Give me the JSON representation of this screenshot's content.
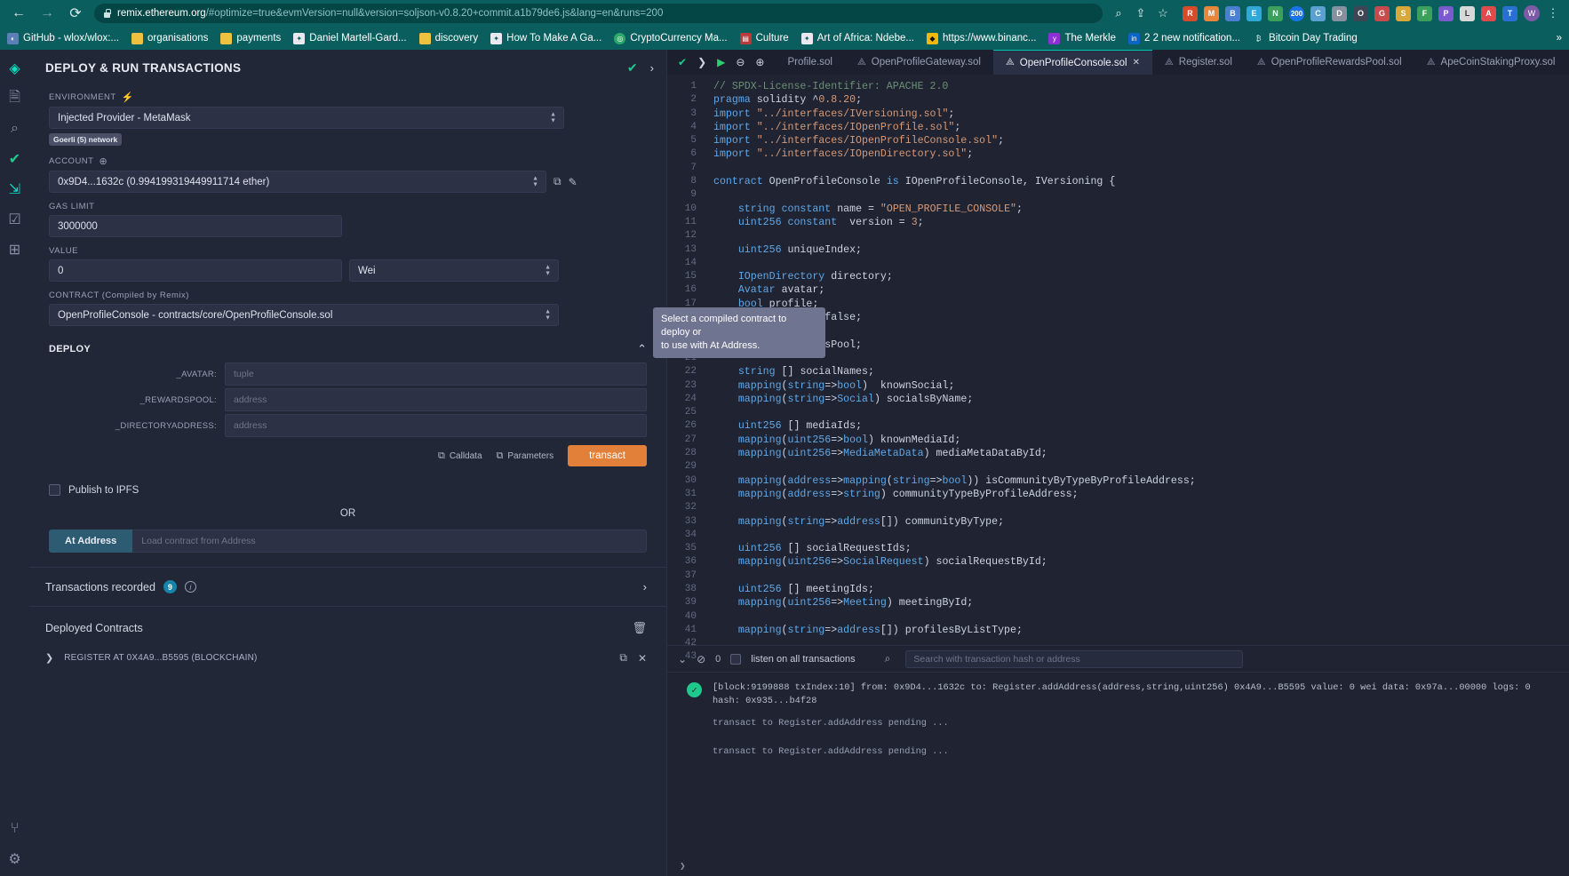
{
  "browser": {
    "nav": {
      "back": "←",
      "forward": "→",
      "reload": "⟳"
    },
    "url_main": "remix.ethereum.org",
    "url_rest": "/#optimize=true&evmVersion=null&version=soljson-v0.8.20+commit.a1b79de6.js&lang=en&runs=200",
    "url_icons": [
      "search-icon",
      "share-icon",
      "star-icon"
    ],
    "extensions": [
      "R",
      "M",
      "B",
      "E",
      "N",
      "200",
      "C",
      "D",
      "O",
      "G",
      "S",
      "F",
      "P",
      "L",
      "A",
      "T"
    ],
    "profile_initial": "W",
    "bookmarks": [
      {
        "label": "GitHub - wlox/wlox:...",
        "icon": "github-icon",
        "color": "#5a7fb5"
      },
      {
        "label": "organisations",
        "icon": "folder-icon",
        "color": "#f0c040"
      },
      {
        "label": "payments",
        "icon": "folder-icon",
        "color": "#f0c040"
      },
      {
        "label": "Daniel Martell-Gard...",
        "icon": "globe-icon",
        "color": "#e8eaf0"
      },
      {
        "label": "discovery",
        "icon": "folder-icon",
        "color": "#f0c040"
      },
      {
        "label": "How To Make A Ga...",
        "icon": "globe-icon",
        "color": "#e8eaf0"
      },
      {
        "label": "CryptoCurrency Ma...",
        "icon": "coin-icon",
        "color": "#2ea86a"
      },
      {
        "label": "Culture",
        "icon": "book-icon",
        "color": "#b83a3a"
      },
      {
        "label": "Art of Africa: Ndebe...",
        "icon": "globe-icon",
        "color": "#e8eaf0"
      },
      {
        "label": "https://www.binanc...",
        "icon": "binance-icon",
        "color": "#f0b90b"
      },
      {
        "label": "The Merkle",
        "icon": "merkle-icon",
        "color": "#8e2fd4"
      },
      {
        "label": "2 2 new notification...",
        "icon": "linkedin-icon",
        "color": "#0a66c2"
      },
      {
        "label": "Bitcoin Day Trading",
        "icon": "bitcoin-icon",
        "color": "#0b5e5e"
      }
    ],
    "bookmarks_overflow": "»"
  },
  "iconbar": {
    "items": [
      {
        "name": "remix-logo-icon",
        "glyph": "◈",
        "active": true
      },
      {
        "name": "file-explorer-icon",
        "glyph": "🗎",
        "active": false
      },
      {
        "name": "search-icon",
        "glyph": "⌕",
        "active": false
      },
      {
        "name": "solidity-compiler-icon",
        "glyph": "✔",
        "active": false
      },
      {
        "name": "deploy-run-icon",
        "glyph": "⇲",
        "active": true
      },
      {
        "name": "testing-icon",
        "glyph": "☑",
        "active": false
      },
      {
        "name": "plugin-manager-icon",
        "glyph": "⊞",
        "active": false
      }
    ],
    "bottom": [
      {
        "name": "git-icon",
        "glyph": "⑂"
      },
      {
        "name": "settings-gear-icon",
        "glyph": "⚙"
      }
    ]
  },
  "deploy_panel": {
    "title": "DEPLOY & RUN TRANSACTIONS",
    "header_icons": {
      "check": "✔",
      "chevron": "›"
    },
    "environment": {
      "label": "ENVIRONMENT",
      "plug_icon": "🔌",
      "value": "Injected Provider - MetaMask",
      "network_badge": "Goerli (5) network"
    },
    "account": {
      "label": "ACCOUNT",
      "add_icon": "⊕",
      "value": "0x9D4...1632c (0.994199319449911714 ether)",
      "copy_icon": "copy-icon",
      "edit_icon": "edit-icon"
    },
    "gas_limit": {
      "label": "GAS LIMIT",
      "value": "3000000"
    },
    "value": {
      "label": "VALUE",
      "value": "0",
      "unit": "Wei"
    },
    "contract": {
      "label": "CONTRACT (Compiled by Remix)",
      "value": "OpenProfileConsole - contracts/core/OpenProfileConsole.sol"
    },
    "deploy": {
      "title": "DEPLOY",
      "params": [
        {
          "label": "_AVATAR:",
          "placeholder": "tuple"
        },
        {
          "label": "_REWARDSPOOL:",
          "placeholder": "address"
        },
        {
          "label": "_DIRECTORYADDRESS:",
          "placeholder": "address"
        }
      ],
      "calldata_label": "Calldata",
      "parameters_label": "Parameters",
      "transact_label": "transact"
    },
    "publish_ipfs_label": "Publish to IPFS",
    "or_label": "OR",
    "at_address": {
      "button": "At Address",
      "placeholder": "Load contract from Address"
    },
    "transactions_recorded": {
      "label": "Transactions recorded",
      "count": "9",
      "info_icon": "i"
    },
    "deployed_contracts": {
      "title": "Deployed Contracts",
      "trash_icon": "🗑",
      "items": [
        {
          "caret": "❯",
          "name": "REGISTER AT 0X4A9...B5595 (BLOCKCHAIN)",
          "copy_icon": "⧉",
          "close_icon": "✕"
        }
      ]
    }
  },
  "tooltip": {
    "line1": "Select a compiled contract to deploy or",
    "line2": "to use with At Address."
  },
  "editor": {
    "controls": {
      "check": "✔",
      "chevron": "❯",
      "run": "▶",
      "zoom_out": "⊖",
      "zoom_in": "⊕"
    },
    "tabs": [
      {
        "label": "Profile.sol",
        "active": false,
        "icon": "solidity-icon",
        "closable": false
      },
      {
        "label": "OpenProfileGateway.sol",
        "active": false,
        "icon": "solidity-icon",
        "closable": false
      },
      {
        "label": "OpenProfileConsole.sol",
        "active": true,
        "icon": "solidity-icon",
        "closable": true
      },
      {
        "label": "Register.sol",
        "active": false,
        "icon": "solidity-icon",
        "closable": false
      },
      {
        "label": "OpenProfileRewardsPool.sol",
        "active": false,
        "icon": "solidity-icon",
        "closable": false
      },
      {
        "label": "ApeCoinStakingProxy.sol",
        "active": false,
        "icon": "solidity-icon",
        "closable": false
      }
    ],
    "first_line": 1,
    "last_line": 42,
    "code_lines": [
      "// SPDX-License-Identifier: APACHE 2.0",
      "pragma solidity ^0.8.20;",
      "import \"../interfaces/IVersioning.sol\";",
      "import \"../interfaces/IOpenProfile.sol\";",
      "import \"../interfaces/IOpenProfileConsole.sol\";",
      "import \"../interfaces/IOpenDirectory.sol\";",
      "",
      "contract OpenProfileConsole is IOpenProfileConsole, IVersioning {",
      "",
      "    string constant name = \"OPEN_PROFILE_CONSOLE\";",
      "    uint256 constant  version = 3;",
      "",
      "    uint256 uniqueIndex;",
      "",
      "    IOpenDirectory directory;",
      "    Avatar avatar;",
      "    bool profile;",
      "    bool locked = false;",
      "",
      "    address rewardsPool;",
      "",
      "    string [] socialNames;",
      "    mapping(string=>bool)  knownSocial;",
      "    mapping(string=>Social) socialsByName;",
      "",
      "    uint256 [] mediaIds;",
      "    mapping(uint256=>bool) knownMediaId;",
      "    mapping(uint256=>MediaMetaData) mediaMetaDataById;",
      "",
      "    mapping(address=>mapping(string=>bool)) isCommunityByTypeByProfileAddress;",
      "    mapping(address=>string) communityTypeByProfileAddress;",
      "",
      "    mapping(string=>address[]) communityByType;",
      "",
      "    uint256 [] socialRequestIds;",
      "    mapping(uint256=>SocialRequest) socialRequestById;",
      "",
      "    uint256 [] meetingIds;",
      "    mapping(uint256=>Meeting) meetingById;",
      "",
      "    mapping(string=>address[]) profilesByListType;",
      ""
    ]
  },
  "terminal": {
    "toolbar": {
      "collapse_icon": "⌄",
      "clear_icon": "⊘",
      "count": "0",
      "listen_label": "listen on all transactions",
      "search_icon": "⌕",
      "search_placeholder": "Search with transaction hash or address"
    },
    "entries": [
      {
        "status": "success",
        "status_icon": "✓",
        "line1": "[block:9199888 txIndex:10] from: 0x9D4...1632c to: Register.addAddress(address,string,uint256) 0x4A9...B5595 value: 0 wei data: 0x97a...00000 logs: 0",
        "line2": "hash: 0x935...b4f28"
      }
    ],
    "pending_lines": [
      "transact to Register.addAddress pending ...",
      "transact to Register.addAddress pending ..."
    ],
    "prompt": "❯"
  }
}
